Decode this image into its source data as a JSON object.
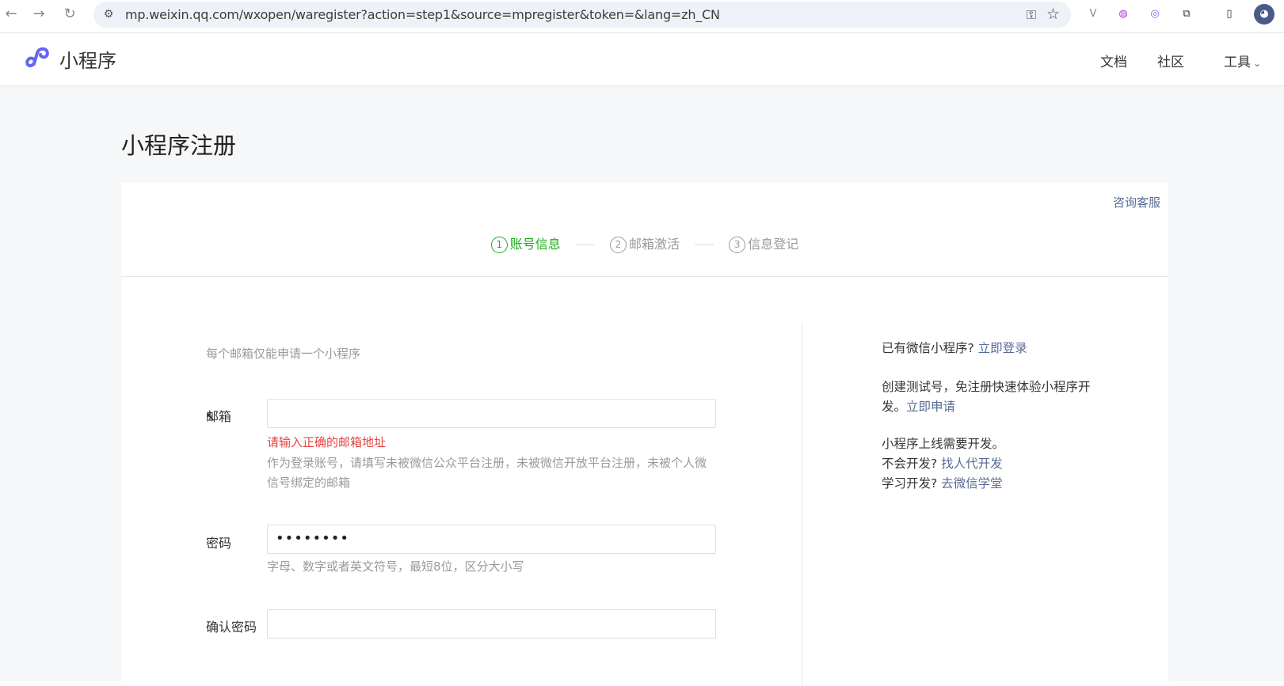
{
  "browser": {
    "url": "mp.weixin.qq.com/wxopen/waregister?action=step1&source=mpregister&token=&lang=zh_CN",
    "icons": [
      "back-icon",
      "forward-icon",
      "reload-icon",
      "site-info-icon",
      "key-icon",
      "star-icon",
      "extension-icon",
      "sidebar-icon",
      "avatar"
    ]
  },
  "header": {
    "logo_text": "小程序",
    "nav": [
      "文档",
      "社区",
      "工具"
    ]
  },
  "page": {
    "title": "小程序注册",
    "consult": "咨询客服",
    "steps": [
      {
        "num": "1",
        "label": "账号信息",
        "active": true
      },
      {
        "num": "2",
        "label": "邮箱激活",
        "active": false
      },
      {
        "num": "3",
        "label": "信息登记",
        "active": false
      }
    ]
  },
  "form": {
    "intro": "每个邮箱仅能申请一个小程序",
    "email_label": "邮箱",
    "email_value": "",
    "email_error": "请输入正确的邮箱地址",
    "email_hint": "作为登录账号，请填写未被微信公众平台注册，未被微信开放平台注册，未被个人微信号绑定的邮箱",
    "password_label": "密码",
    "password_value": "••••••••",
    "password_hint": "字母、数字或者英文符号，最短8位，区分大小写",
    "confirm_label": "确认密码"
  },
  "side": {
    "have_app": "已有微信小程序?",
    "login_link": "立即登录",
    "test_text": "创建测试号，免注册快速体验小程序开发。",
    "apply_link": "立即申请",
    "need_dev": "小程序上线需要开发。",
    "no_dev": "不会开发?",
    "find_dev_link": "找人代开发",
    "learn_dev": "学习开发?",
    "academy_link": "去微信学堂"
  },
  "colors": {
    "accent_green": "#1aad19",
    "link": "#576b95",
    "error": "#e64340"
  }
}
